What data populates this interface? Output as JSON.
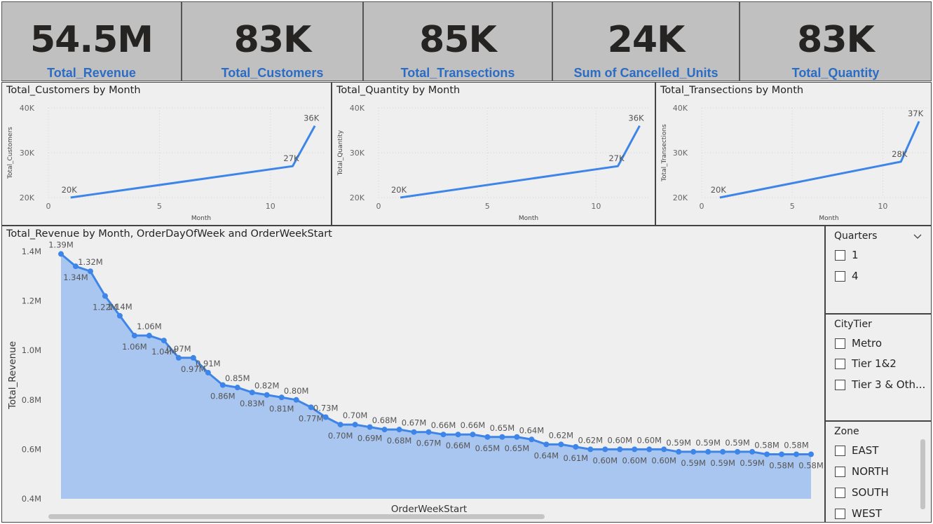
{
  "kpis": [
    {
      "value": "54.5M",
      "label": "Total_Revenue"
    },
    {
      "value": "83K",
      "label": "Total_Customers"
    },
    {
      "value": "85K",
      "label": "Total_Transections"
    },
    {
      "value": "24K",
      "label": "Sum of Cancelled_Units"
    },
    {
      "value": "83K",
      "label": "Total_Quantity"
    }
  ],
  "charts": {
    "customers": {
      "title": "Total_Customers by Month"
    },
    "quantity": {
      "title": "Total_Quantity by Month"
    },
    "transections": {
      "title": "Total_Transections by Month"
    },
    "revenue": {
      "title": "Total_Revenue by Month, OrderDayOfWeek and OrderWeekStart"
    }
  },
  "slicers": {
    "quarters": {
      "title": "Quarters",
      "options": [
        "1",
        "4"
      ]
    },
    "citytier": {
      "title": "CityTier",
      "options": [
        "Metro",
        "Tier 1&2",
        "Tier 3 & Oth..."
      ]
    },
    "zone": {
      "title": "Zone",
      "options": [
        "EAST",
        "NORTH",
        "SOUTH",
        "WEST"
      ]
    }
  },
  "colors": {
    "accent": "#3d85e8",
    "area_fill": "#a9c6f0",
    "kpi_label": "#2b6cc4",
    "kpi_bg": "#c0c0c0",
    "panel_bg": "#efefef"
  },
  "icons": {
    "quarters_dropdown": "chevron-down-icon"
  },
  "chart_data": [
    {
      "id": "customers",
      "type": "line",
      "title": "Total_Customers by Month",
      "xlabel": "Month",
      "ylabel": "Total_Customers",
      "x": [
        1,
        11,
        12
      ],
      "values": [
        20000,
        27000,
        36000
      ],
      "labels": [
        "20K",
        "27K",
        "36K"
      ],
      "xticks": [
        "0",
        "5",
        "10"
      ],
      "yticks": [
        "20K",
        "30K",
        "40K"
      ],
      "xlim": [
        0,
        12.5
      ],
      "ylim": [
        20000,
        40000
      ],
      "grid": true
    },
    {
      "id": "quantity",
      "type": "line",
      "title": "Total_Quantity by Month",
      "xlabel": "Month",
      "ylabel": "Total_Quantity",
      "x": [
        1,
        11,
        12
      ],
      "values": [
        20000,
        27000,
        36000
      ],
      "labels": [
        "20K",
        "27K",
        "36K"
      ],
      "xticks": [
        "0",
        "5",
        "10"
      ],
      "yticks": [
        "20K",
        "30K",
        "40K"
      ],
      "xlim": [
        0,
        12.5
      ],
      "ylim": [
        20000,
        40000
      ],
      "grid": true
    },
    {
      "id": "transections",
      "type": "line",
      "title": "Total_Transections by Month",
      "xlabel": "Month",
      "ylabel": "Total_Transections",
      "x": [
        1,
        11,
        12
      ],
      "values": [
        20000,
        28000,
        37000
      ],
      "labels": [
        "20K",
        "28K",
        "37K"
      ],
      "xticks": [
        "0",
        "5",
        "10"
      ],
      "yticks": [
        "20K",
        "30K",
        "40K"
      ],
      "xlim": [
        0,
        12.5
      ],
      "ylim": [
        20000,
        40000
      ],
      "grid": true
    },
    {
      "id": "revenue",
      "type": "area",
      "title": "Total_Revenue by Month, OrderDayOfWeek and OrderWeekStart",
      "xlabel": "OrderWeekStart",
      "ylabel": "Total_Revenue",
      "yticks": [
        "0.4M",
        "0.6M",
        "0.8M",
        "1.0M",
        "1.2M",
        "1.4M"
      ],
      "ylim": [
        0.4,
        1.4
      ],
      "grid": false,
      "values": [
        1.39,
        1.34,
        1.32,
        1.22,
        1.14,
        1.06,
        1.06,
        1.04,
        0.97,
        0.97,
        0.91,
        0.86,
        0.85,
        0.83,
        0.82,
        0.81,
        0.8,
        0.77,
        0.73,
        0.7,
        0.7,
        0.69,
        0.68,
        0.68,
        0.67,
        0.67,
        0.66,
        0.66,
        0.66,
        0.65,
        0.65,
        0.65,
        0.64,
        0.62,
        0.62,
        0.61,
        0.6,
        0.6,
        0.6,
        0.6,
        0.6,
        0.6,
        0.59,
        0.59,
        0.59,
        0.59,
        0.59,
        0.59,
        0.58,
        0.58,
        0.58,
        0.58
      ],
      "labels": [
        "1.39M",
        "1.34M",
        "1.32M",
        "1.22M",
        "1.14M",
        "1.06M",
        "1.06M",
        "1.04M",
        "0.97M",
        "0.97M",
        "0.91M",
        "0.86M",
        "0.85M",
        "0.83M",
        "0.82M",
        "0.81M",
        "0.80M",
        "0.77M",
        "0.73M",
        "0.70M",
        "0.70M",
        "0.69M",
        "0.68M",
        "0.68M",
        "0.67M",
        "0.67M",
        "0.66M",
        "0.66M",
        "0.66M",
        "0.65M",
        "0.65M",
        "0.65M",
        "0.64M",
        "0.64M",
        "0.62M",
        "0.61M",
        "0.62M",
        "0.60M",
        "0.60M",
        "0.60M",
        "0.60M",
        "0.60M",
        "0.59M",
        "0.59M",
        "0.59M",
        "0.59M",
        "0.59M",
        "0.59M",
        "0.58M",
        "0.58M",
        "0.58M",
        "0.58M"
      ]
    }
  ]
}
